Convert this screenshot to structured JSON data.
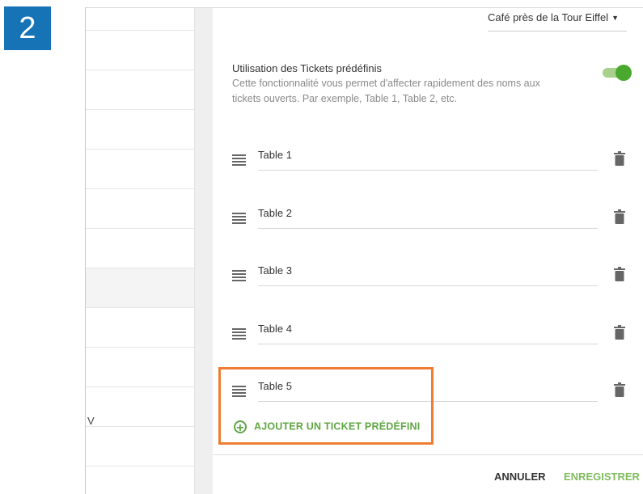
{
  "step_badge": "2",
  "header": {
    "store_select": "Café près de la Tour Eiffel"
  },
  "left_panel": {
    "partial_text": "V"
  },
  "feature": {
    "title": "Utilisation des Tickets prédéfinis",
    "description": "Cette fonctionnalité vous permet d'affecter rapidement des noms aux tickets ouverts. Par exemple, Table 1, Table 2, etc.",
    "enabled": true
  },
  "tickets": [
    {
      "name": "Table 1"
    },
    {
      "name": "Table 2"
    },
    {
      "name": "Table 3"
    },
    {
      "name": "Table 4"
    },
    {
      "name": "Table 5"
    }
  ],
  "add_ticket_label": "AJOUTER UN TICKET PRÉDÉFINI",
  "footer": {
    "cancel_label": "ANNULER",
    "save_label": "ENREGISTRER"
  },
  "colors": {
    "accent_green": "#5fa643",
    "highlight_orange": "#ee7d31",
    "badge_blue": "#1573b6"
  }
}
